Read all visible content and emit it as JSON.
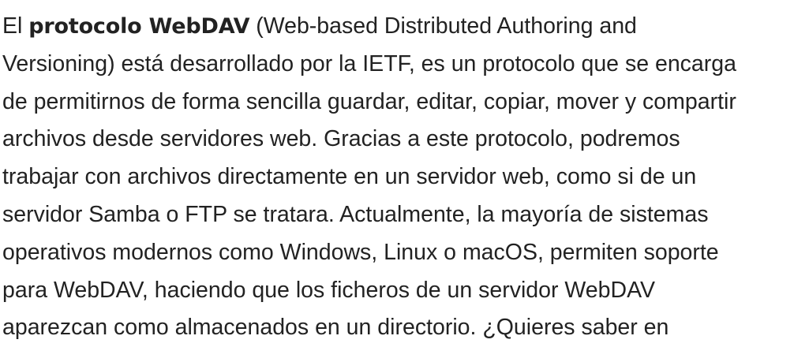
{
  "paragraph": {
    "lines": [
      {
        "before": "El ",
        "bold": "protocolo WebDAV",
        "after": " (Web-based Distributed Authoring and"
      },
      {
        "text": "Versioning) está desarrollado por la IETF, es un protocolo que se encarga"
      },
      {
        "text": "de permitirnos de forma sencilla guardar, editar, copiar, mover y compartir"
      },
      {
        "text": "archivos desde servidores web. Gracias a este protocolo, podremos"
      },
      {
        "text": "trabajar con archivos directamente en un servidor web, como si de un"
      },
      {
        "text": "servidor Samba o FTP se tratara. Actualmente, la mayoría de sistemas"
      },
      {
        "text": "operativos modernos como Windows, Linux o macOS, permiten soporte"
      },
      {
        "text": "para WebDAV, haciendo que los ficheros de un servidor WebDAV"
      },
      {
        "text": "aparezcan como almacenados en un directorio. ¿Quieres saber en"
      }
    ]
  }
}
